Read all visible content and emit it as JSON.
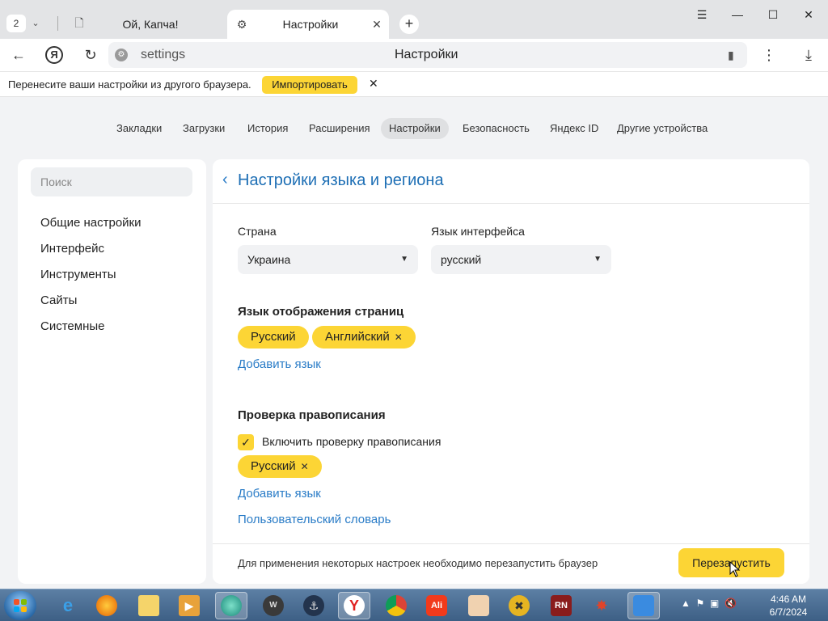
{
  "browser": {
    "tab_count": "2",
    "tabs": [
      {
        "title": "Ой, Капча!"
      },
      {
        "title": "Настройки"
      }
    ],
    "address": {
      "url": "settings",
      "page_title": "Настройки"
    }
  },
  "import_bar": {
    "message": "Перенесите ваши настройки из другого браузера.",
    "button": "Импортировать"
  },
  "top_nav": {
    "items": [
      "Закладки",
      "Загрузки",
      "История",
      "Расширения",
      "Настройки",
      "Безопасность",
      "Яндекс ID",
      "Другие устройства"
    ],
    "active": "Настройки"
  },
  "sidebar": {
    "search_placeholder": "Поиск",
    "items": [
      "Общие настройки",
      "Интерфейс",
      "Инструменты",
      "Сайты",
      "Системные"
    ]
  },
  "main": {
    "title": "Настройки языка и региона",
    "country": {
      "label": "Страна",
      "value": "Украина"
    },
    "ui_language": {
      "label": "Язык интерфейса",
      "value": "русский"
    },
    "page_langs": {
      "heading": "Язык отображения страниц",
      "chips": [
        "Русский",
        "Английский"
      ],
      "add_link": "Добавить язык"
    },
    "spellcheck": {
      "heading": "Проверка правописания",
      "checkbox_label": "Включить проверку правописания",
      "checked": true,
      "chips": [
        "Русский"
      ],
      "add_link": "Добавить язык",
      "dictionary_link": "Пользовательский словарь"
    },
    "footer": {
      "note": "Для применения некоторых настроек необходимо перезапустить браузер",
      "restart_button": "Перезапустить"
    }
  },
  "taskbar": {
    "apps": [
      "start-button",
      "internet-explorer-icon",
      "firefox-icon",
      "file-explorer-icon",
      "media-player-icon",
      "app-globe-icon",
      "world-of-tanks-icon",
      "world-of-warships-icon",
      "yandex-browser-icon",
      "chrome-icon",
      "aliexpress-icon",
      "game-icon",
      "game-icon-2",
      "game-rn-icon",
      "game-icon-3",
      "network-app-icon"
    ],
    "clock_time": "4:46 AM",
    "clock_date": "6/7/2024"
  },
  "colors": {
    "accent_yellow": "#fcd535",
    "link_blue": "#2a7cc7",
    "title_blue": "#1e6fb5"
  }
}
